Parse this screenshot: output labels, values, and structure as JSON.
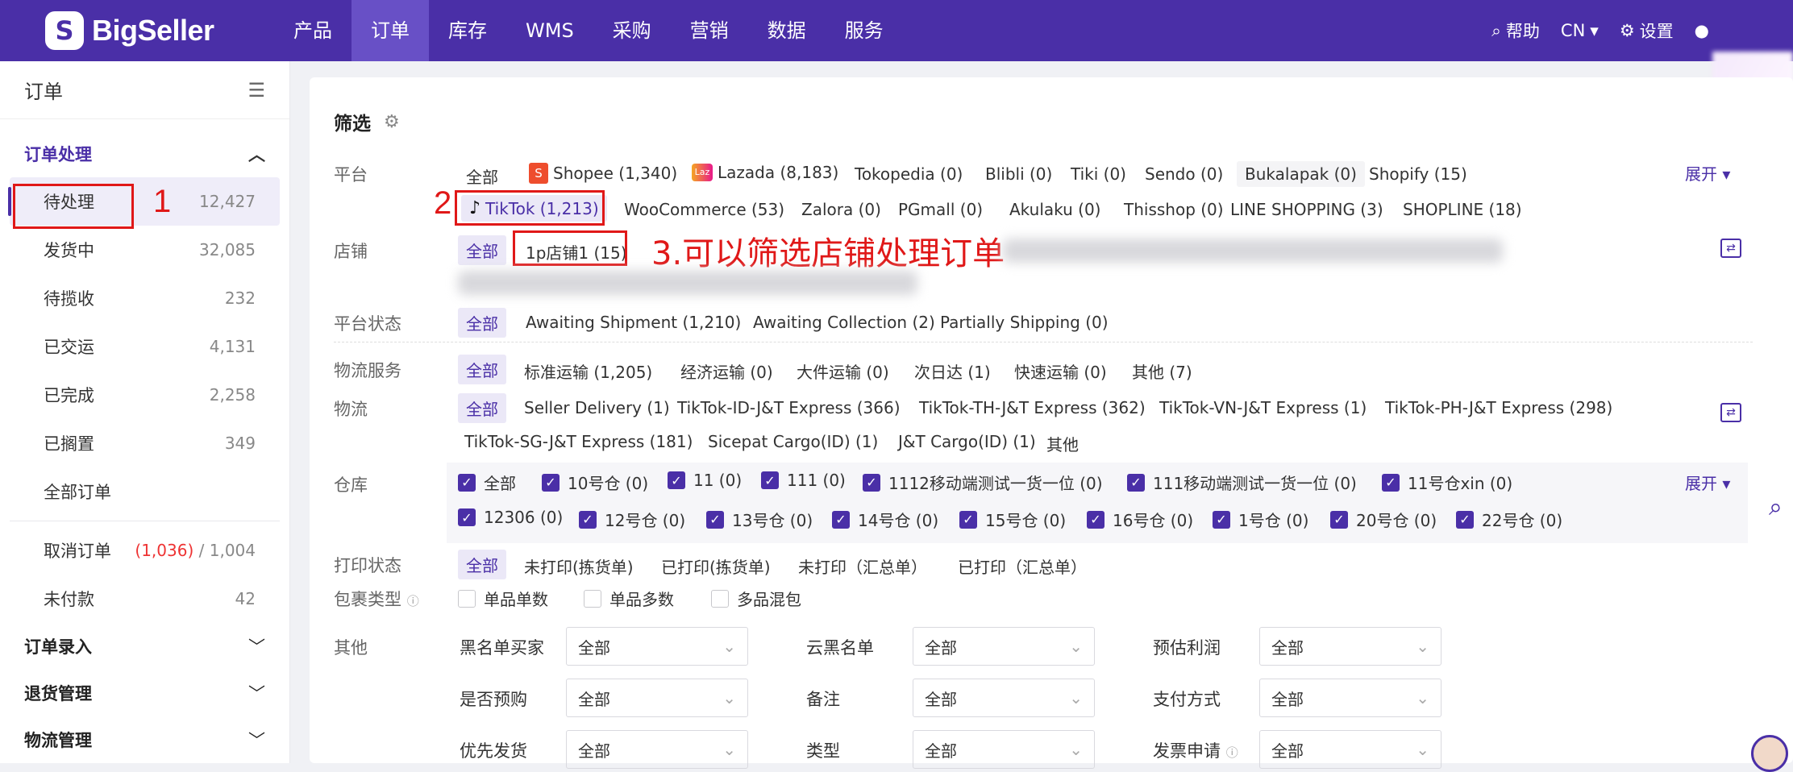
{
  "brand": {
    "logo_text": "BigSeller"
  },
  "nav": [
    "产品",
    "订单",
    "库存",
    "WMS",
    "采购",
    "营销",
    "数据",
    "服务"
  ],
  "top_right": {
    "help": "帮助",
    "lang": "CN",
    "settings": "设置"
  },
  "sidebar": {
    "title": "订单",
    "group1": "订单处理",
    "items": [
      {
        "label": "待处理",
        "count": "12,427"
      },
      {
        "label": "发货中",
        "count": "32,085"
      },
      {
        "label": "待揽收",
        "count": "232"
      },
      {
        "label": "已交运",
        "count": "4,131"
      },
      {
        "label": "已完成",
        "count": "2,258"
      },
      {
        "label": "已搁置",
        "count": "349"
      },
      {
        "label": "全部订单",
        "count": ""
      }
    ],
    "cancel": {
      "label": "取消订单",
      "red": "(1,036)",
      "rest": " / 1,004"
    },
    "unpaid": {
      "label": "未付款",
      "count": "42"
    },
    "groups": [
      "订单录入",
      "退货管理",
      "物流管理"
    ]
  },
  "filter": {
    "title": "筛选",
    "platform_label": "平台",
    "platform_row1": [
      "全部",
      "Shopee (1,340)",
      "Lazada (8,183)",
      "Tokopedia (0)",
      "Blibli (0)",
      "Tiki (0)",
      "Sendo (0)",
      "Bukalapak (0)",
      "Shopify (15)"
    ],
    "platform_row2": [
      "TikTok (1,213)",
      "WooCommerce (53)",
      "Zalora (0)",
      "PGmall (0)",
      "Akulaku (0)",
      "Thisshop (0)",
      "LINE SHOPPING (3)",
      "SHOPLINE (18)"
    ],
    "expand": "展开",
    "store_label": "店铺",
    "store_items": [
      "全部",
      "1p店铺1 (15)"
    ],
    "status_label": "平台状态",
    "status_items": [
      "全部",
      "Awaiting Shipment (1,210)",
      "Awaiting Collection (2)",
      "Partially Shipping (0)"
    ],
    "service_label": "物流服务",
    "service_items": [
      "全部",
      "标准运输 (1,205)",
      "经济运输 (0)",
      "大件运输 (0)",
      "次日达 (1)",
      "快速运输 (0)",
      "其他 (7)"
    ],
    "logistics_label": "物流",
    "logistics_row1": [
      "全部",
      "Seller Delivery (1)",
      "TikTok-ID-J&T Express (366)",
      "TikTok-TH-J&T Express (362)",
      "TikTok-VN-J&T Express (1)",
      "TikTok-PH-J&T Express (298)"
    ],
    "logistics_row2": [
      "TikTok-SG-J&T Express (181)",
      "Sicepat Cargo(ID) (1)",
      "J&T Cargo(ID) (1)",
      "其他"
    ],
    "warehouse_label": "仓库",
    "warehouse_row1": [
      "全部",
      "10号仓 (0)",
      "11 (0)",
      "111 (0)",
      "1112移动端测试一货一位 (0)",
      "111移动端测试一货一位 (0)",
      "11号仓xin (0)"
    ],
    "warehouse_row2": [
      "12306 (0)",
      "12号仓 (0)",
      "13号仓 (0)",
      "14号仓 (0)",
      "15号仓 (0)",
      "16号仓 (0)",
      "1号仓 (0)",
      "20号仓 (0)",
      "22号仓 (0)"
    ],
    "print_label": "打印状态",
    "print_items": [
      "全部",
      "未打印(拣货单)",
      "已打印(拣货单)",
      "未打印（汇总单）",
      "已打印（汇总单）"
    ],
    "package_label": "包裹类型",
    "package_items": [
      "单品单数",
      "单品多数",
      "多品混包"
    ],
    "other_label": "其他",
    "selects": [
      {
        "label": "黑名单买家",
        "value": "全部"
      },
      {
        "label": "云黑名单",
        "value": "全部"
      },
      {
        "label": "预估利润",
        "value": "全部"
      },
      {
        "label": "是否预购",
        "value": "全部"
      },
      {
        "label": "备注",
        "value": "全部"
      },
      {
        "label": "支付方式",
        "value": "全部"
      },
      {
        "label": "优先发货",
        "value": "全部"
      },
      {
        "label": "类型",
        "value": "全部"
      },
      {
        "label": "发票申请",
        "value": "全部"
      }
    ]
  },
  "annotations": {
    "n1": "1",
    "n2": "2",
    "n3": "3.可以筛选店铺处理订单"
  }
}
